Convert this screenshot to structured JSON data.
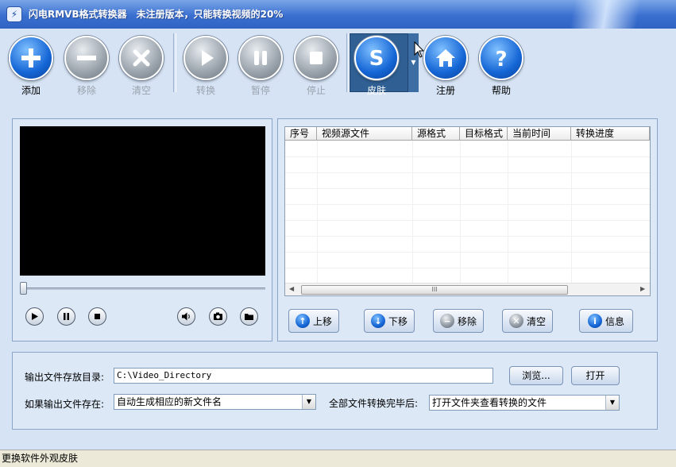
{
  "window": {
    "title": "闪电RMVB格式转换器　未注册版本，只能转换视频的20%"
  },
  "toolbar": {
    "add": "添加",
    "remove": "移除",
    "clear": "清空",
    "convert": "转换",
    "pause": "暂停",
    "stop": "停止",
    "skin": "皮肤",
    "register": "注册",
    "help": "帮助"
  },
  "player": {
    "seek_position": 0
  },
  "file_table": {
    "columns": [
      "序号",
      "视频源文件",
      "源格式",
      "目标格式",
      "当前时间",
      "转换进度"
    ],
    "rows": [],
    "scroll_grip": "III"
  },
  "list_actions": {
    "move_up": "上移",
    "move_down": "下移",
    "remove": "移除",
    "clear": "清空",
    "info": "信息"
  },
  "output": {
    "dir_label": "输出文件存放目录:",
    "dir_value": "C:\\Video_Directory",
    "browse": "浏览...",
    "open": "打开",
    "exists_label": "如果输出文件存在:",
    "exists_value": "自动生成相应的新文件名",
    "after_label": "全部文件转换完毕后:",
    "after_value": "打开文件夹查看转换的文件"
  },
  "status": {
    "text": "更换软件外观皮肤"
  }
}
